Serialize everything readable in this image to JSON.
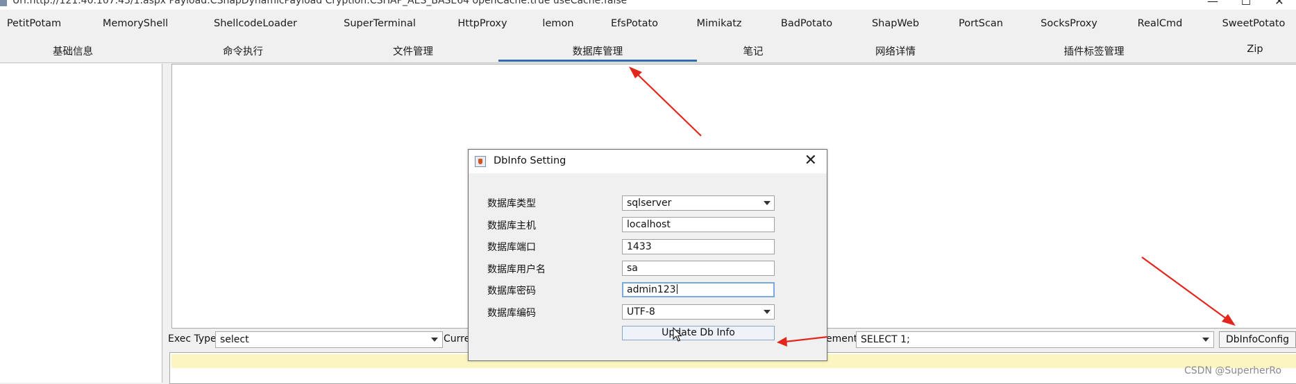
{
  "window": {
    "title": "Url:http://121.40.107.43/1.aspx Payload:CShapDynamicPayload Cryption:CSHAP_AES_BASE64 openCache:true useCache:false",
    "controls": [
      "—",
      "☐",
      "✕"
    ]
  },
  "plugin_tabs": [
    "PetitPotam",
    "MemoryShell",
    "ShellcodeLoader",
    "SuperTerminal",
    "HttpProxy",
    "lemon",
    "EfsPotato",
    "Mimikatz",
    "BadPotato",
    "ShapWeb",
    "PortScan",
    "SocksProxy",
    "RealCmd",
    "SweetPotato"
  ],
  "function_tabs": [
    "基础信息",
    "命令执行",
    "文件管理",
    "数据库管理",
    "笔记",
    "网络详情",
    "插件标签管理",
    "Zip"
  ],
  "active_function_tab": "数据库管理",
  "exec_bar": {
    "exec_type_label": "Exec Type",
    "exec_type_value": "select",
    "current_label_partial": "Curre",
    "statement_label_partial": "ement",
    "statement_value": "SELECT 1;",
    "dbinfo_button": "DbInfoConfig"
  },
  "dialog": {
    "title": "DbInfo Setting",
    "close_icon": "✕",
    "fields": [
      {
        "label": "数据库类型",
        "value": "sqlserver",
        "type": "select"
      },
      {
        "label": "数据库主机",
        "value": "localhost",
        "type": "text"
      },
      {
        "label": "数据库端口",
        "value": "1433",
        "type": "text"
      },
      {
        "label": "数据库用户名",
        "value": "sa",
        "type": "text"
      },
      {
        "label": "数据库密码",
        "value": "admin123",
        "type": "text"
      },
      {
        "label": "数据库编码",
        "value": "UTF-8",
        "type": "select"
      }
    ],
    "update_button": "Update Db Info"
  },
  "watermark": "CSDN @SuperherRo",
  "annotation_color": "#e3261c",
  "accent_color": "#2f6db0"
}
